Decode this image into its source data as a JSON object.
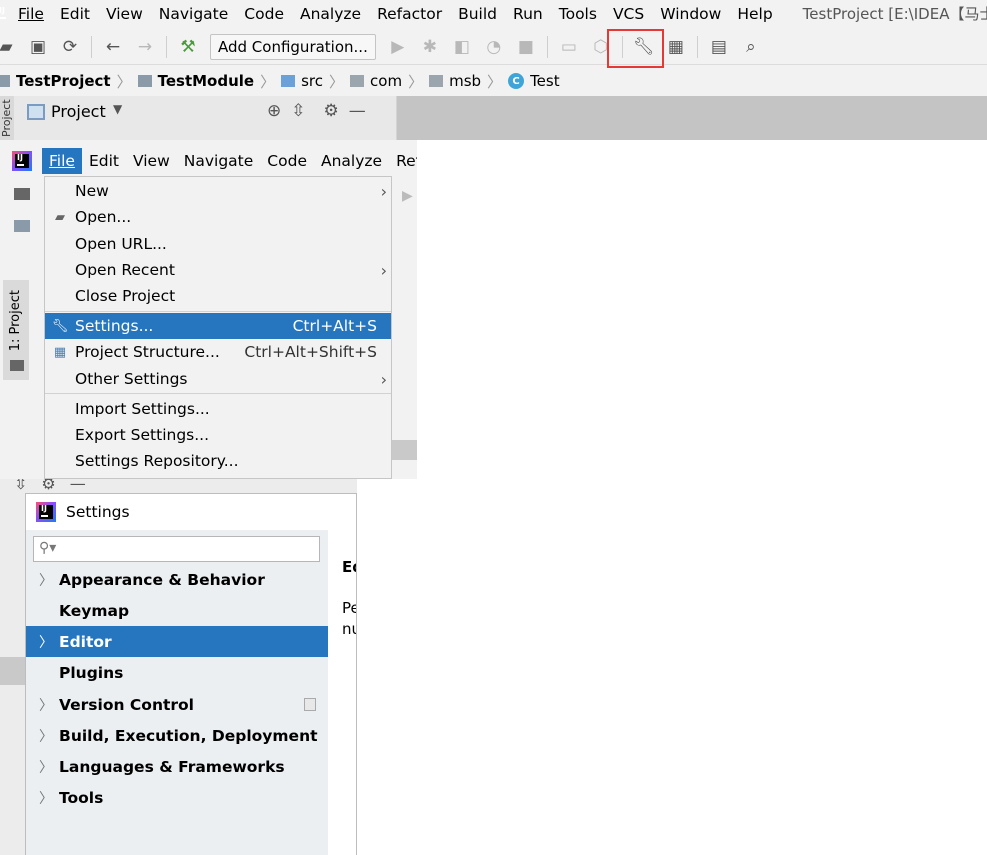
{
  "menubar": {
    "items": [
      "File",
      "Edit",
      "View",
      "Navigate",
      "Code",
      "Analyze",
      "Refactor",
      "Build",
      "Run",
      "Tools",
      "VCS",
      "Window",
      "Help"
    ],
    "window_title": "TestProject [E:\\IDEA【马士"
  },
  "toolbar": {
    "add_configuration": "Add Configuration...",
    "icons": [
      "open-folder-icon",
      "save-icon",
      "sync-icon",
      "back-icon",
      "forward-icon",
      "build-hammer-icon",
      "run-icon",
      "debug-icon",
      "coverage-icon",
      "profile-icon",
      "stop-icon",
      "attach-icon",
      "ant-icon",
      "settings-wrench-icon",
      "project-structure-icon",
      "terminal-icon",
      "search-icon"
    ],
    "highlight_color": "#e53935"
  },
  "breadcrumb": {
    "items": [
      "TestProject",
      "TestModule",
      "src",
      "com",
      "msb",
      "Test"
    ]
  },
  "project_panel": {
    "label": "Project",
    "side_tab": "Project"
  },
  "file_window": {
    "menubar": [
      "File",
      "Edit",
      "View",
      "Navigate",
      "Code",
      "Analyze",
      "Ref"
    ],
    "side_tab": "1: Project"
  },
  "file_menu": {
    "items": [
      {
        "label": "New",
        "submenu": true
      },
      {
        "label": "Open...",
        "icon": "open-folder-icon"
      },
      {
        "label": "Open URL..."
      },
      {
        "label": "Open Recent",
        "submenu": true
      },
      {
        "label": "Close Project"
      },
      {
        "label": "Settings...",
        "shortcut": "Ctrl+Alt+S",
        "icon": "wrench-icon",
        "selected": true
      },
      {
        "label": "Project Structure...",
        "shortcut": "Ctrl+Alt+Shift+S",
        "icon": "project-structure-icon"
      },
      {
        "label": "Other Settings",
        "submenu": true
      },
      {
        "label": "Import Settings..."
      },
      {
        "label": "Export Settings..."
      },
      {
        "label": "Settings Repository..."
      }
    ],
    "selection_color": "#2675bf"
  },
  "settings_dialog": {
    "title": "Settings",
    "search_placeholder": "",
    "tree": [
      {
        "label": "Appearance & Behavior",
        "expandable": true
      },
      {
        "label": "Keymap",
        "expandable": false
      },
      {
        "label": "Editor",
        "expandable": true,
        "selected": true
      },
      {
        "label": "Plugins",
        "expandable": false
      },
      {
        "label": "Version Control",
        "expandable": true
      },
      {
        "label": "Build, Execution, Deployment",
        "expandable": true
      },
      {
        "label": "Languages & Frameworks",
        "expandable": true
      },
      {
        "label": "Tools",
        "expandable": true
      }
    ],
    "content_heading": "Ed",
    "content_line1": "Pe",
    "content_line2": "nu"
  }
}
